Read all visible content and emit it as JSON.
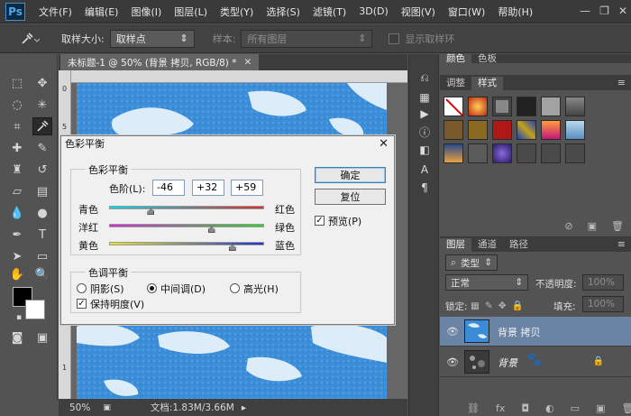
{
  "app": {
    "logo": "Ps"
  },
  "menu": [
    "文件(F)",
    "编辑(E)",
    "图像(I)",
    "图层(L)",
    "类型(Y)",
    "选择(S)",
    "滤镜(T)",
    "3D(D)",
    "视图(V)",
    "窗口(W)",
    "帮助(H)"
  ],
  "window_controls": {
    "minimize": "—",
    "restore": "❐",
    "close": "✕"
  },
  "options_bar": {
    "sample_size_label": "取样大小:",
    "sample_size_value": "取样点",
    "sample_label": "样本:",
    "sample_value": "所有图层",
    "show_ring_label": "显示取样环"
  },
  "document": {
    "tab_title": "未标题-1 @ 50% (背景 拷贝, RGB/8) *",
    "ruler_v_top": "0",
    "ruler_v_1": "5",
    "ruler_v_2": "1",
    "zoom": "50%",
    "doc_info": "文档:1.83M/3.66M"
  },
  "dialog": {
    "title": "色彩平衡",
    "close": "✕",
    "balance_group_title": "色彩平衡",
    "levels_label": "色阶(L):",
    "level_values": [
      "-46",
      "+32",
      "+59"
    ],
    "sliders": [
      {
        "left": "青色",
        "right": "红色",
        "value": -46
      },
      {
        "left": "洋红",
        "right": "绿色",
        "value": 32
      },
      {
        "left": "黄色",
        "right": "蓝色",
        "value": 59
      }
    ],
    "tone_group_title": "色调平衡",
    "tone_options": [
      "阴影(S)",
      "中间调(D)",
      "高光(H)"
    ],
    "tone_selected": "中间调(D)",
    "preserve_luminosity_label": "保持明度(V)",
    "preserve_luminosity_checked": true,
    "ok_label": "确定",
    "reset_label": "复位",
    "preview_label": "预览(P)",
    "preview_checked": true
  },
  "panels": {
    "top_tabs": [
      "颜色",
      "色板"
    ],
    "second_tabs": [
      "调整",
      "样式"
    ],
    "layers_tabs": [
      "图层",
      "通道",
      "路径"
    ],
    "filter_kind": "类型",
    "blend_mode": "正常",
    "opacity_label": "不透明度:",
    "opacity_value": "100%",
    "lock_label": "锁定:",
    "fill_label": "填充:",
    "fill_value": "100%",
    "layers": [
      {
        "name": "背景 拷贝",
        "selected": true
      },
      {
        "name": "背景",
        "selected": false
      }
    ]
  },
  "colors": {
    "accent_selected_layer": "#6a84a6",
    "canvas_blue": "#3b8cd6",
    "foreground": "#000000",
    "background": "#ffffff"
  }
}
